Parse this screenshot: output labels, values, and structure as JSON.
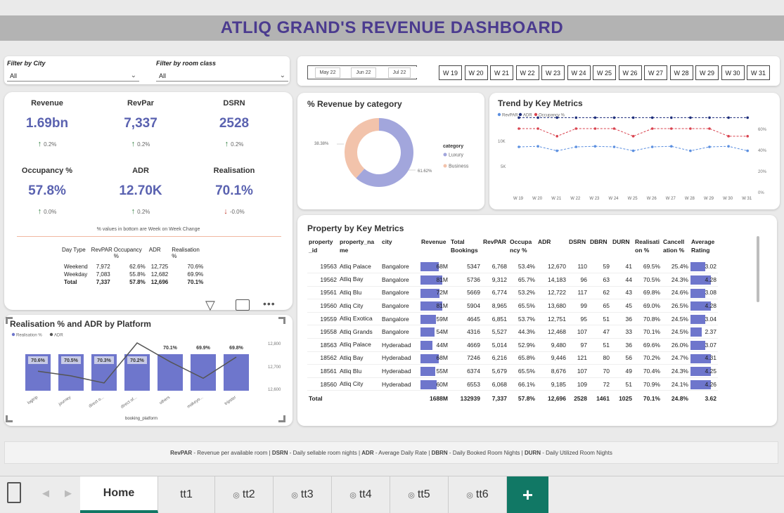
{
  "title": "ATLIQ GRAND'S REVENUE DASHBOARD",
  "filters": {
    "city_label": "Filter by City",
    "city_value": "All",
    "room_label": "Filter by room class",
    "room_value": "All"
  },
  "months": [
    "May 22",
    "Jun 22",
    "Jul 22"
  ],
  "weeks": [
    "W 19",
    "W 20",
    "W 21",
    "W 22",
    "W 23",
    "W 24",
    "W 25",
    "W 26",
    "W 27",
    "W 28",
    "W 29",
    "W 30",
    "W 31"
  ],
  "kpis": [
    {
      "label": "Revenue",
      "value": "1.69bn",
      "change": "0.2%",
      "dir": "up"
    },
    {
      "label": "RevPar",
      "value": "7,337",
      "change": "0.2%",
      "dir": "up"
    },
    {
      "label": "DSRN",
      "value": "2528",
      "change": "0.2%",
      "dir": "up"
    },
    {
      "label": "Occupancy %",
      "value": "57.8%",
      "change": "0.0%",
      "dir": "up"
    },
    {
      "label": "ADR",
      "value": "12.70K",
      "change": "0.2%",
      "dir": "up"
    },
    {
      "label": "Realisation",
      "value": "70.1%",
      "change": "-0.0%",
      "dir": "down"
    }
  ],
  "kpi_note": "% values in bottom are Week on Week Change",
  "daytype": {
    "headers": [
      "Day Type",
      "RevPAR",
      "Occupancy %",
      "ADR",
      "Realisation %"
    ],
    "rows": [
      [
        "Weekend",
        "7,972",
        "62.6%",
        "12,725",
        "70.6%"
      ],
      [
        "Weekday",
        "7,083",
        "55.8%",
        "12,682",
        "69.9%"
      ],
      [
        "Total",
        "7,337",
        "57.8%",
        "12,696",
        "70.1%"
      ]
    ]
  },
  "donut": {
    "title": "% Revenue by category",
    "legend_title": "category",
    "labels": [
      "Luxury",
      "Business"
    ],
    "values": [
      61.62,
      38.38
    ],
    "pct_labels": [
      "61.62%",
      "38.38%"
    ],
    "colors": [
      "#a2a6dc",
      "#f2c3ab"
    ]
  },
  "trend": {
    "title": "Trend by Key Metrics",
    "legend": [
      "RevPAR",
      "ADR",
      "Occupancy %"
    ],
    "colors": [
      "#5b8fe0",
      "#1d2d7a",
      "#d9434f"
    ],
    "left_ticks": [
      "10K",
      "5K"
    ],
    "right_ticks": [
      "60%",
      "40%",
      "20%",
      "0%"
    ],
    "x": [
      "W 19",
      "W 20",
      "W 21",
      "W 22",
      "W 23",
      "W 24",
      "W 25",
      "W 26",
      "W 27",
      "W 28",
      "W 29",
      "W 30",
      "W 31"
    ],
    "revpar": [
      7500,
      7600,
      6800,
      7500,
      7600,
      7500,
      6800,
      7500,
      7600,
      6800,
      7500,
      7600,
      6800,
      7500
    ],
    "adr": [
      12700,
      12700,
      12700,
      12700,
      12700,
      12700,
      12700,
      12700,
      12700,
      12700,
      12700,
      12700,
      12700
    ],
    "occupancy": [
      60,
      60,
      53,
      60,
      60,
      60,
      53,
      60,
      60,
      60,
      60,
      53,
      53
    ]
  },
  "property": {
    "title": "Property by Key Metrics",
    "headers": [
      "property_id",
      "property_name",
      "city",
      "Revenue",
      "Total Bookings",
      "RevPAR",
      "Occupancy %",
      "ADR",
      "DSRN",
      "DBRN",
      "DURN",
      "Realisation %",
      "Cancellation %",
      "Average Rating"
    ],
    "header_display": [
      "property\n_id",
      "property_na\nme",
      "city",
      "Revenue",
      "Total\nBookings",
      "RevPAR",
      "Occupa\nncy %",
      "ADR",
      "DSRN",
      "DBRN",
      "DURN",
      "Realisati\non %",
      "Cancell\nation %",
      "Average\nRating"
    ],
    "rows": [
      [
        "19563",
        "Atliq Palace",
        "Bangalore",
        "68M",
        "5347",
        "6,768",
        "53.4%",
        "12,670",
        "110",
        "59",
        "41",
        "69.5%",
        "25.4%",
        "3.02"
      ],
      [
        "19562",
        "Atliq Bay",
        "Bangalore",
        "81M",
        "5736",
        "9,312",
        "65.7%",
        "14,183",
        "96",
        "63",
        "44",
        "70.5%",
        "24.3%",
        "4.28"
      ],
      [
        "19561",
        "Atliq Blu",
        "Bangalore",
        "72M",
        "5669",
        "6,774",
        "53.2%",
        "12,722",
        "117",
        "62",
        "43",
        "69.8%",
        "24.6%",
        "3.08"
      ],
      [
        "19560",
        "Atliq City",
        "Bangalore",
        "81M",
        "5904",
        "8,965",
        "65.5%",
        "13,680",
        "99",
        "65",
        "45",
        "69.0%",
        "26.5%",
        "4.28"
      ],
      [
        "19559",
        "Atliq Exotica",
        "Bangalore",
        "59M",
        "4645",
        "6,851",
        "53.7%",
        "12,751",
        "95",
        "51",
        "36",
        "70.8%",
        "24.5%",
        "3.04"
      ],
      [
        "19558",
        "Atliq Grands",
        "Bangalore",
        "54M",
        "4316",
        "5,527",
        "44.3%",
        "12,468",
        "107",
        "47",
        "33",
        "70.1%",
        "24.5%",
        "2.37"
      ],
      [
        "18563",
        "Atliq Palace",
        "Hyderabad",
        "44M",
        "4669",
        "5,014",
        "52.9%",
        "9,480",
        "97",
        "51",
        "36",
        "69.6%",
        "26.0%",
        "3.07"
      ],
      [
        "18562",
        "Atliq Bay",
        "Hyderabad",
        "68M",
        "7246",
        "6,216",
        "65.8%",
        "9,446",
        "121",
        "80",
        "56",
        "70.2%",
        "24.7%",
        "4.31"
      ],
      [
        "18561",
        "Atliq Blu",
        "Hyderabad",
        "55M",
        "6374",
        "5,679",
        "65.5%",
        "8,676",
        "107",
        "70",
        "49",
        "70.4%",
        "24.3%",
        "4.25"
      ],
      [
        "18560",
        "Atliq City",
        "Hyderabad",
        "60M",
        "6553",
        "6,068",
        "66.1%",
        "9,185",
        "109",
        "72",
        "51",
        "70.9%",
        "24.1%",
        "4.26"
      ]
    ],
    "revenue_values": [
      68,
      81,
      72,
      81,
      59,
      54,
      44,
      68,
      55,
      60
    ],
    "rating_values": [
      3.02,
      4.28,
      3.08,
      4.28,
      3.04,
      2.37,
      3.07,
      4.31,
      4.25,
      4.26
    ],
    "total": [
      "Total",
      "",
      "",
      "1688M",
      "132939",
      "7,337",
      "57.8%",
      "12,696",
      "2528",
      "1461",
      "1025",
      "70.1%",
      "24.8%",
      "3.62"
    ]
  },
  "platform": {
    "title": "Realisation % and ADR by Platform",
    "legend": [
      "Realisation %",
      "ADR"
    ],
    "xlabel": "booking_platform",
    "categories": [
      "logtrip",
      "journey",
      "direct o...",
      "direct of...",
      "others",
      "makeyo...",
      "tripster"
    ],
    "realisation": [
      70.6,
      70.5,
      70.3,
      70.2,
      70.1,
      69.9,
      69.8
    ],
    "realisation_labels": [
      "70.6%",
      "70.5%",
      "70.3%",
      "70.2%",
      "70.1%",
      "69.9%",
      "69.8%"
    ],
    "adr": [
      12680,
      12660,
      12630,
      12800,
      12720,
      12650,
      12740
    ],
    "right_ticks": [
      "12,800",
      "12,700",
      "12,600"
    ]
  },
  "glossary": [
    {
      "term": "RevPAR",
      "desc": " - Revenue per available room | "
    },
    {
      "term": "DSRN",
      "desc": " - Daily sellable room nights | "
    },
    {
      "term": "ADR",
      "desc": " - Average Daily Rate | "
    },
    {
      "term": "DBRN",
      "desc": " - Daily Booked Room Nights | "
    },
    {
      "term": "DURN",
      "desc": " - Daily Utilized Room Nights"
    }
  ],
  "tabs": [
    "Home",
    "tt1",
    "tt2",
    "tt3",
    "tt4",
    "tt5",
    "tt6"
  ],
  "add_tab": "+"
}
